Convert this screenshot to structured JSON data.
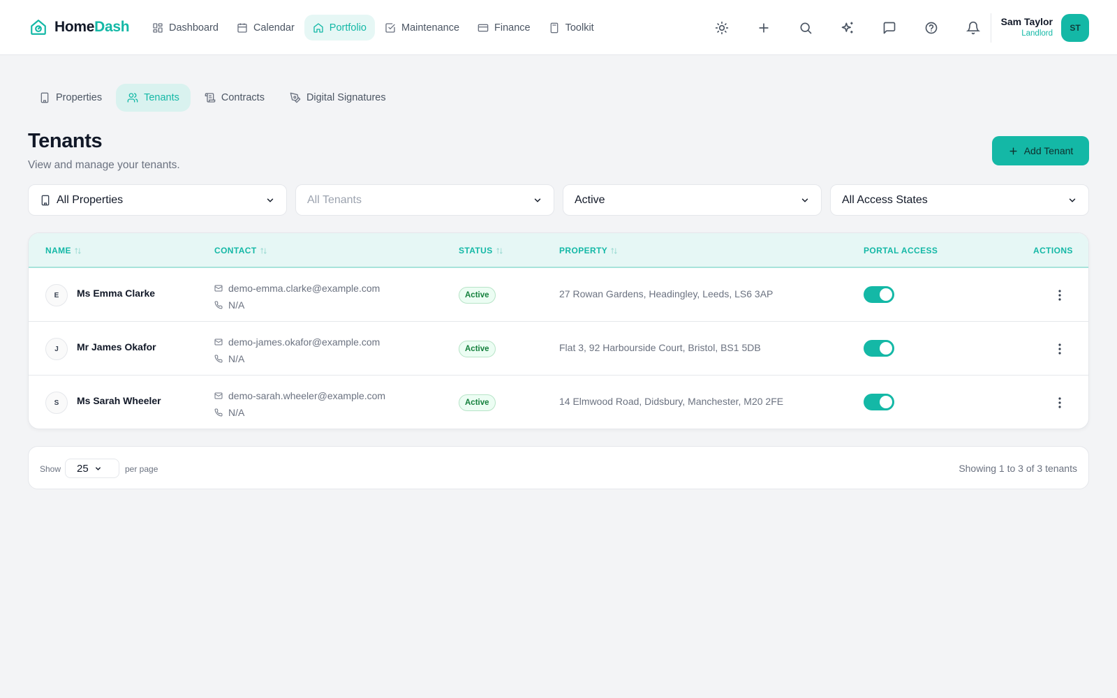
{
  "app": {
    "logo_home": "Home",
    "logo_dash": "Dash"
  },
  "nav": [
    {
      "label": "Dashboard",
      "icon": "dashboard-icon",
      "active": false
    },
    {
      "label": "Calendar",
      "icon": "calendar-icon",
      "active": false
    },
    {
      "label": "Portfolio",
      "icon": "home-icon",
      "active": true
    },
    {
      "label": "Maintenance",
      "icon": "checkbox-icon",
      "active": false
    },
    {
      "label": "Finance",
      "icon": "credit-card-icon",
      "active": false
    },
    {
      "label": "Toolkit",
      "icon": "calculator-icon",
      "active": false
    }
  ],
  "top_icons": [
    "sun-icon",
    "plus-icon",
    "search-icon",
    "sparkles-icon",
    "message-icon",
    "help-icon",
    "bell-icon"
  ],
  "user": {
    "name": "Sam Taylor",
    "role": "Landlord",
    "initials": "ST"
  },
  "subtabs": [
    {
      "label": "Properties",
      "icon": "building-icon",
      "active": false
    },
    {
      "label": "Tenants",
      "icon": "users-icon",
      "active": true
    },
    {
      "label": "Contracts",
      "icon": "scroll-icon",
      "active": false
    },
    {
      "label": "Digital Signatures",
      "icon": "pen-tool-icon",
      "active": false
    }
  ],
  "page": {
    "title": "Tenants",
    "subtitle": "View and manage your tenants.",
    "add_button": "Add Tenant"
  },
  "filters": {
    "property": "All Properties",
    "tenant": "All Tenants",
    "status": "Active",
    "access": "All Access States"
  },
  "table": {
    "columns": {
      "name": "NAME",
      "contact": "CONTACT",
      "status": "STATUS",
      "property": "PROPERTY",
      "portal": "PORTAL ACCESS",
      "actions": "ACTIONS"
    },
    "rows": [
      {
        "initial": "E",
        "name": "Ms Emma Clarke",
        "email": "demo-emma.clarke@example.com",
        "phone": "N/A",
        "status": "Active",
        "property": "27 Rowan Gardens, Headingley, Leeds, LS6 3AP",
        "portal_access": true
      },
      {
        "initial": "J",
        "name": "Mr James Okafor",
        "email": "demo-james.okafor@example.com",
        "phone": "N/A",
        "status": "Active",
        "property": "Flat 3, 92 Harbourside Court, Bristol, BS1 5DB",
        "portal_access": true
      },
      {
        "initial": "S",
        "name": "Ms Sarah Wheeler",
        "email": "demo-sarah.wheeler@example.com",
        "phone": "N/A",
        "status": "Active",
        "property": "14 Elmwood Road, Didsbury, Manchester, M20 2FE",
        "portal_access": true
      }
    ]
  },
  "pagination": {
    "show_label": "Show",
    "per_page_value": "25",
    "per_page_label": "per page",
    "summary": "Showing 1 to 3 of 3 tenants"
  },
  "colors": {
    "accent": "#14b8a6",
    "active_badge": "#15803d",
    "background": "#f3f4f6"
  }
}
